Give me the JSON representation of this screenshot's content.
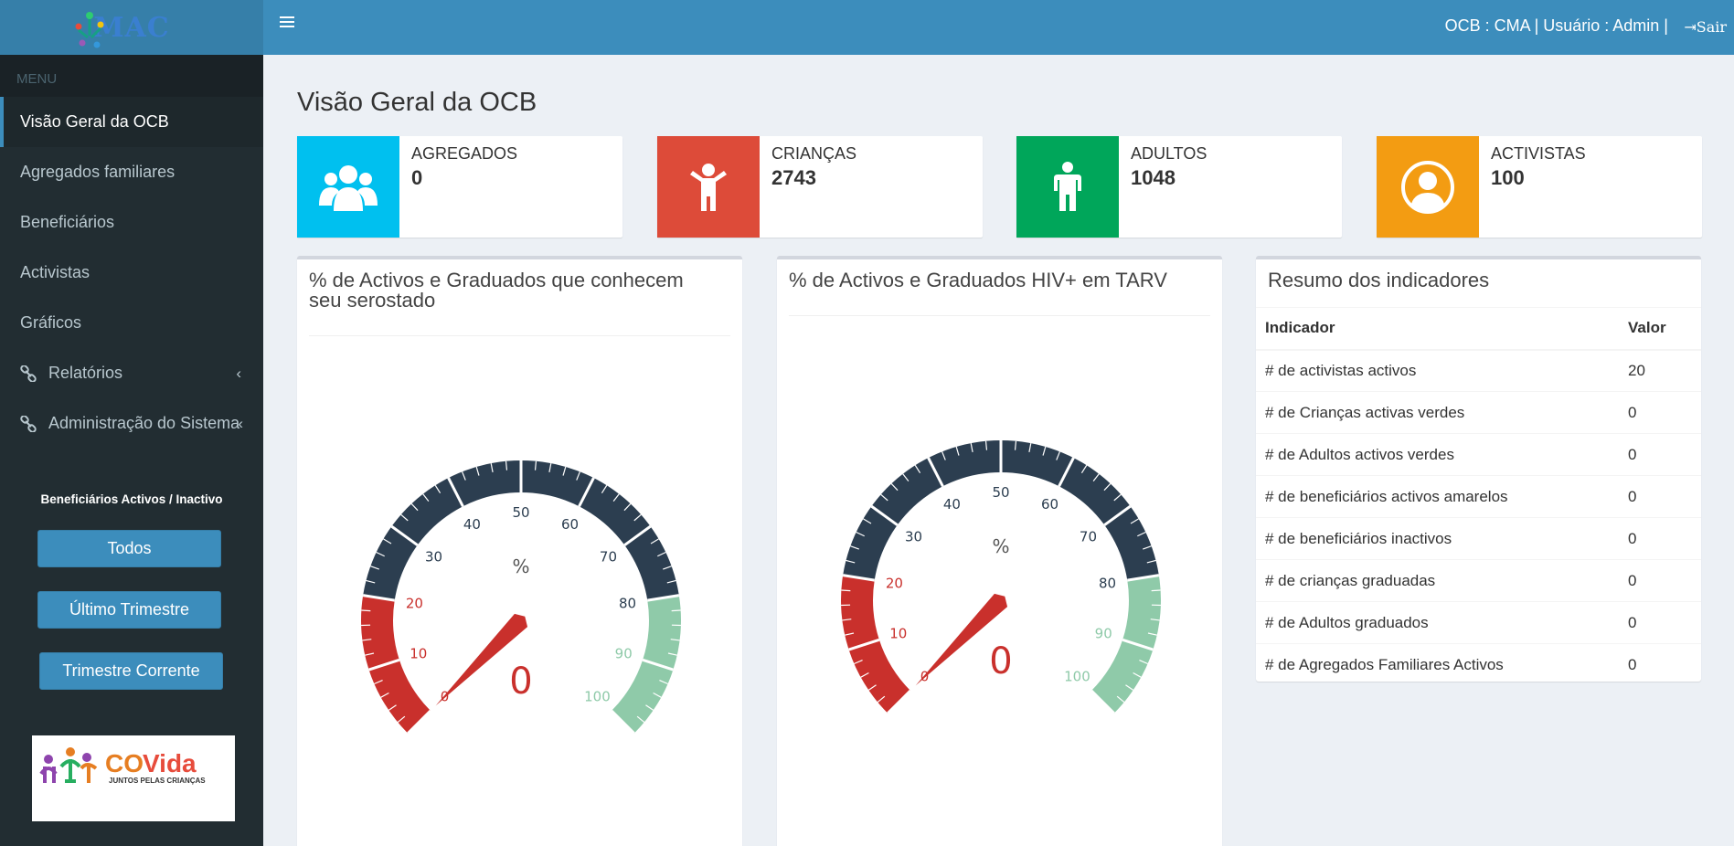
{
  "header": {
    "logo_text": "MAC",
    "user_info": "OCB : CMA | Usuário : Admin |",
    "logout_label": "Sair"
  },
  "sidebar": {
    "menu_header": "MENU",
    "items": [
      {
        "label": "Visão Geral da OCB",
        "active": true
      },
      {
        "label": "Agregados familiares"
      },
      {
        "label": "Beneficiários"
      },
      {
        "label": "Activistas"
      },
      {
        "label": "Gráficos"
      },
      {
        "label": "Relatórios",
        "icon": "link-icon",
        "submenu": true
      },
      {
        "label": "Administração do Sistema",
        "icon": "link-icon",
        "submenu": true
      }
    ],
    "filter_title": "Beneficiários Activos / Inactivo",
    "buttons": [
      "Todos",
      "Último Trimestre",
      "Trimestre Corrente"
    ],
    "partner_logo": {
      "name": "COVida",
      "tagline": "JUNTOS PELAS CRIANÇAS"
    }
  },
  "main": {
    "title": "Visão Geral da OCB",
    "info_boxes": [
      {
        "label": "AGREGADOS",
        "value": "0",
        "color": "#00c0ef",
        "icon": "users-icon"
      },
      {
        "label": "CRIANÇAS",
        "value": "2743",
        "color": "#dd4b39",
        "icon": "child-icon"
      },
      {
        "label": "ADULTOS",
        "value": "1048",
        "color": "#00a65a",
        "icon": "male-icon"
      },
      {
        "label": "ACTIVISTAS",
        "value": "100",
        "color": "#f39c12",
        "icon": "user-circle-icon"
      }
    ],
    "gauges": [
      {
        "title": "% de Activos e Graduados que conhecem seu serostado",
        "unit": "%",
        "value": 0
      },
      {
        "title": "% de Activos e Graduados HIV+ em TARV",
        "unit": "%",
        "value": 0
      }
    ],
    "gauge_ticks": [
      "0",
      "10",
      "20",
      "30",
      "40",
      "50",
      "60",
      "70",
      "80",
      "90",
      "100"
    ],
    "gauge_colors": {
      "low": "#c9302c",
      "mid": "#2c3e50",
      "high": "#8fcaa9"
    },
    "summary": {
      "title": "Resumo dos indicadores",
      "col_indicator": "Indicador",
      "col_value": "Valor",
      "rows": [
        {
          "indicator": "# de activistas activos",
          "value": "20"
        },
        {
          "indicator": "# de Crianças activas verdes",
          "value": "0"
        },
        {
          "indicator": "# de Adultos activos verdes",
          "value": "0"
        },
        {
          "indicator": "# de beneficiários activos amarelos",
          "value": "0"
        },
        {
          "indicator": "# de beneficiários inactivos",
          "value": "0"
        },
        {
          "indicator": "# de crianças graduadas",
          "value": "0"
        },
        {
          "indicator": "# de Adultos graduados",
          "value": "0"
        },
        {
          "indicator": "# de Agregados Familiares Activos",
          "value": "0"
        }
      ]
    }
  }
}
